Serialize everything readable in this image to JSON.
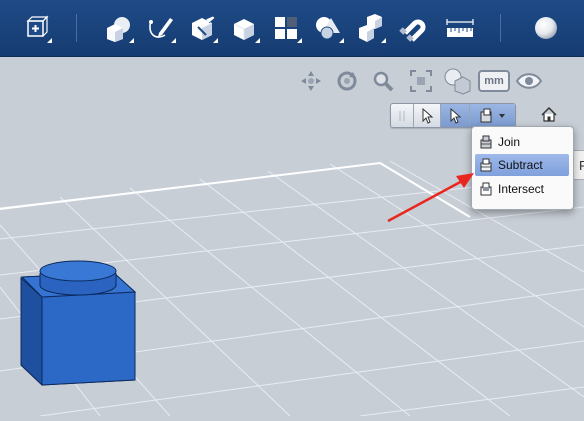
{
  "toolbar": {
    "buttons": [
      {
        "name": "transform-menu",
        "icon": "cube-with-cross-icon"
      },
      {
        "name": "primitives",
        "icon": "primitive-shapes-icon"
      },
      {
        "name": "sketch",
        "icon": "sketch-pen-icon"
      },
      {
        "name": "construct",
        "icon": "construct-icon"
      },
      {
        "name": "modify",
        "icon": "modify-cube-icon"
      },
      {
        "name": "pattern",
        "icon": "pattern-grid-icon"
      },
      {
        "name": "grouping",
        "icon": "grouping-icon"
      },
      {
        "name": "combine",
        "icon": "combine-icon"
      },
      {
        "name": "snap",
        "icon": "magnet-icon"
      },
      {
        "name": "measure",
        "icon": "ruler-icon"
      },
      {
        "name": "material",
        "icon": "sphere-icon"
      }
    ]
  },
  "view_tools": {
    "units_label": "mm"
  },
  "combine_menu": {
    "items": [
      {
        "label": "Join",
        "icon": "join-icon",
        "selected": false
      },
      {
        "label": "Subtract",
        "icon": "subtract-icon",
        "selected": true
      },
      {
        "label": "Intersect",
        "icon": "intersect-icon",
        "selected": false
      }
    ],
    "side_panel_peek": "F"
  },
  "colors": {
    "toolbar": "#1a4480",
    "canvas": "#c8ced6",
    "grid": "#ffffff",
    "shape": "#2a63c0",
    "menu_highlight": "#8aa8e0",
    "arrow": "#e8281e"
  }
}
